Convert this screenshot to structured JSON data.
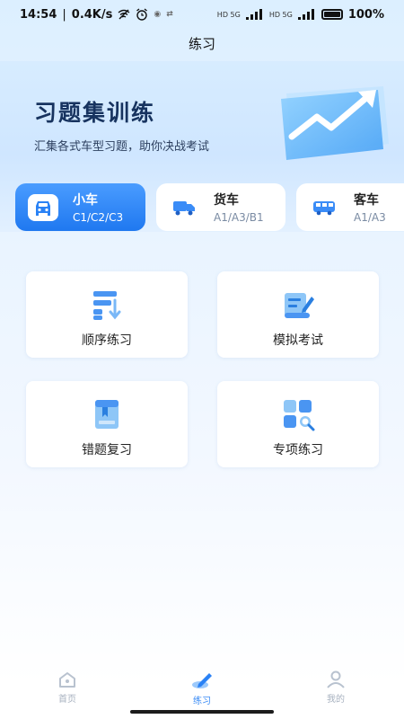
{
  "status_bar": {
    "time": "14:54",
    "net_speed": "0.4K/s",
    "battery": "100%",
    "sim1": "HD 5G",
    "sim2": "HD 5G"
  },
  "nav": {
    "title": "练习"
  },
  "hero": {
    "title": "习题集训练",
    "subtitle": "汇集各式车型习题，助你决战考试"
  },
  "vehicle_tabs": [
    {
      "name": "小车",
      "code": "C1/C2/C3",
      "active": true,
      "icon": "car-icon"
    },
    {
      "name": "货车",
      "code": "A1/A3/B1",
      "active": false,
      "icon": "truck-icon"
    },
    {
      "name": "客车",
      "code": "A1/A3",
      "active": false,
      "icon": "bus-icon"
    }
  ],
  "practice_cards": [
    {
      "label": "顺序练习",
      "icon": "sequential-list-icon"
    },
    {
      "label": "模拟考试",
      "icon": "mock-exam-icon"
    },
    {
      "label": "错题复习",
      "icon": "wrong-questions-book-icon"
    },
    {
      "label": "专项练习",
      "icon": "special-topics-icon"
    }
  ],
  "bottom_nav": [
    {
      "label": "首页",
      "icon": "home-icon",
      "active": false
    },
    {
      "label": "练习",
      "icon": "practice-pencil-icon",
      "active": true
    },
    {
      "label": "我的",
      "icon": "profile-icon",
      "active": false
    }
  ],
  "colors": {
    "accent": "#2a82f5",
    "hero_title": "#17335f",
    "inactive": "#a7b1bf"
  }
}
